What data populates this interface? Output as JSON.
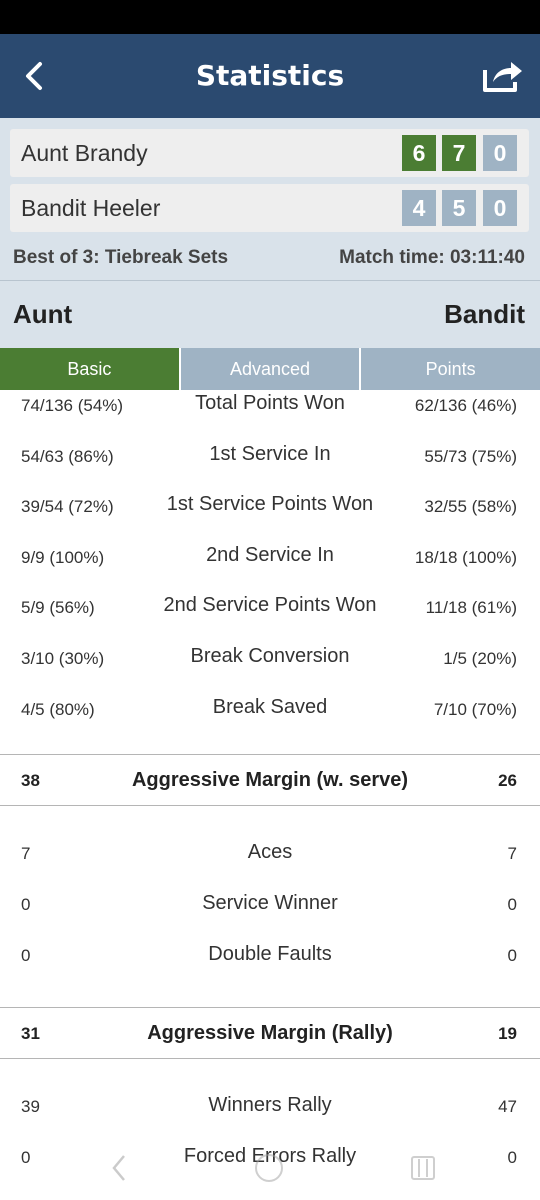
{
  "header": {
    "title": "Statistics",
    "back_icon": "chevron-left-icon",
    "share_icon": "share-icon"
  },
  "score": {
    "players": [
      {
        "name": "Aunt Brandy",
        "sets": [
          "6",
          "7",
          "0"
        ],
        "set_won": [
          true,
          true,
          false
        ]
      },
      {
        "name": "Bandit Heeler",
        "sets": [
          "4",
          "5",
          "0"
        ],
        "set_won": [
          false,
          false,
          false
        ]
      }
    ],
    "format": "Best of 3: Tiebreak Sets",
    "match_time": "Match time:  03:11:40"
  },
  "names": {
    "left": "Aunt",
    "right": "Bandit"
  },
  "tabs": [
    {
      "label": "Basic",
      "active": true
    },
    {
      "label": "Advanced",
      "active": false
    },
    {
      "label": "Points",
      "active": false
    }
  ],
  "basic_stats": [
    {
      "left": "74/136 (54%)",
      "label": "Total Points Won",
      "right": "62/136 (46%)"
    },
    {
      "left": "54/63 (86%)",
      "label": "1st Service In",
      "right": "55/73 (75%)"
    },
    {
      "left": "39/54 (72%)",
      "label": "1st Service Points Won",
      "right": "32/55 (58%)"
    },
    {
      "left": "9/9 (100%)",
      "label": "2nd Service In",
      "right": "18/18 (100%)"
    },
    {
      "left": "5/9 (56%)",
      "label": "2nd Service Points Won",
      "right": "11/18 (61%)"
    },
    {
      "left": "3/10 (30%)",
      "label": "Break Conversion",
      "right": "1/5 (20%)"
    },
    {
      "left": "4/5 (80%)",
      "label": "Break Saved",
      "right": "7/10 (70%)"
    }
  ],
  "margin_serve": {
    "left": "38",
    "label": "Aggressive Margin (w. serve)",
    "right": "26"
  },
  "serve_stats": [
    {
      "left": "7",
      "label": "Aces",
      "right": "7"
    },
    {
      "left": "0",
      "label": "Service Winner",
      "right": "0"
    },
    {
      "left": "0",
      "label": "Double Faults",
      "right": "0"
    }
  ],
  "margin_rally": {
    "left": "31",
    "label": "Aggressive Margin (Rally)",
    "right": "19"
  },
  "rally_stats": [
    {
      "left": "39",
      "label": "Winners Rally",
      "right": "47"
    },
    {
      "left": "0",
      "label": "Forced Errors Rally",
      "right": "0"
    }
  ],
  "colors": {
    "header_bg": "#2b4a70",
    "win_green": "#4b7d33",
    "inactive_blue_gray": "#9fb3c4",
    "panel_bg": "#d9e2ea"
  }
}
